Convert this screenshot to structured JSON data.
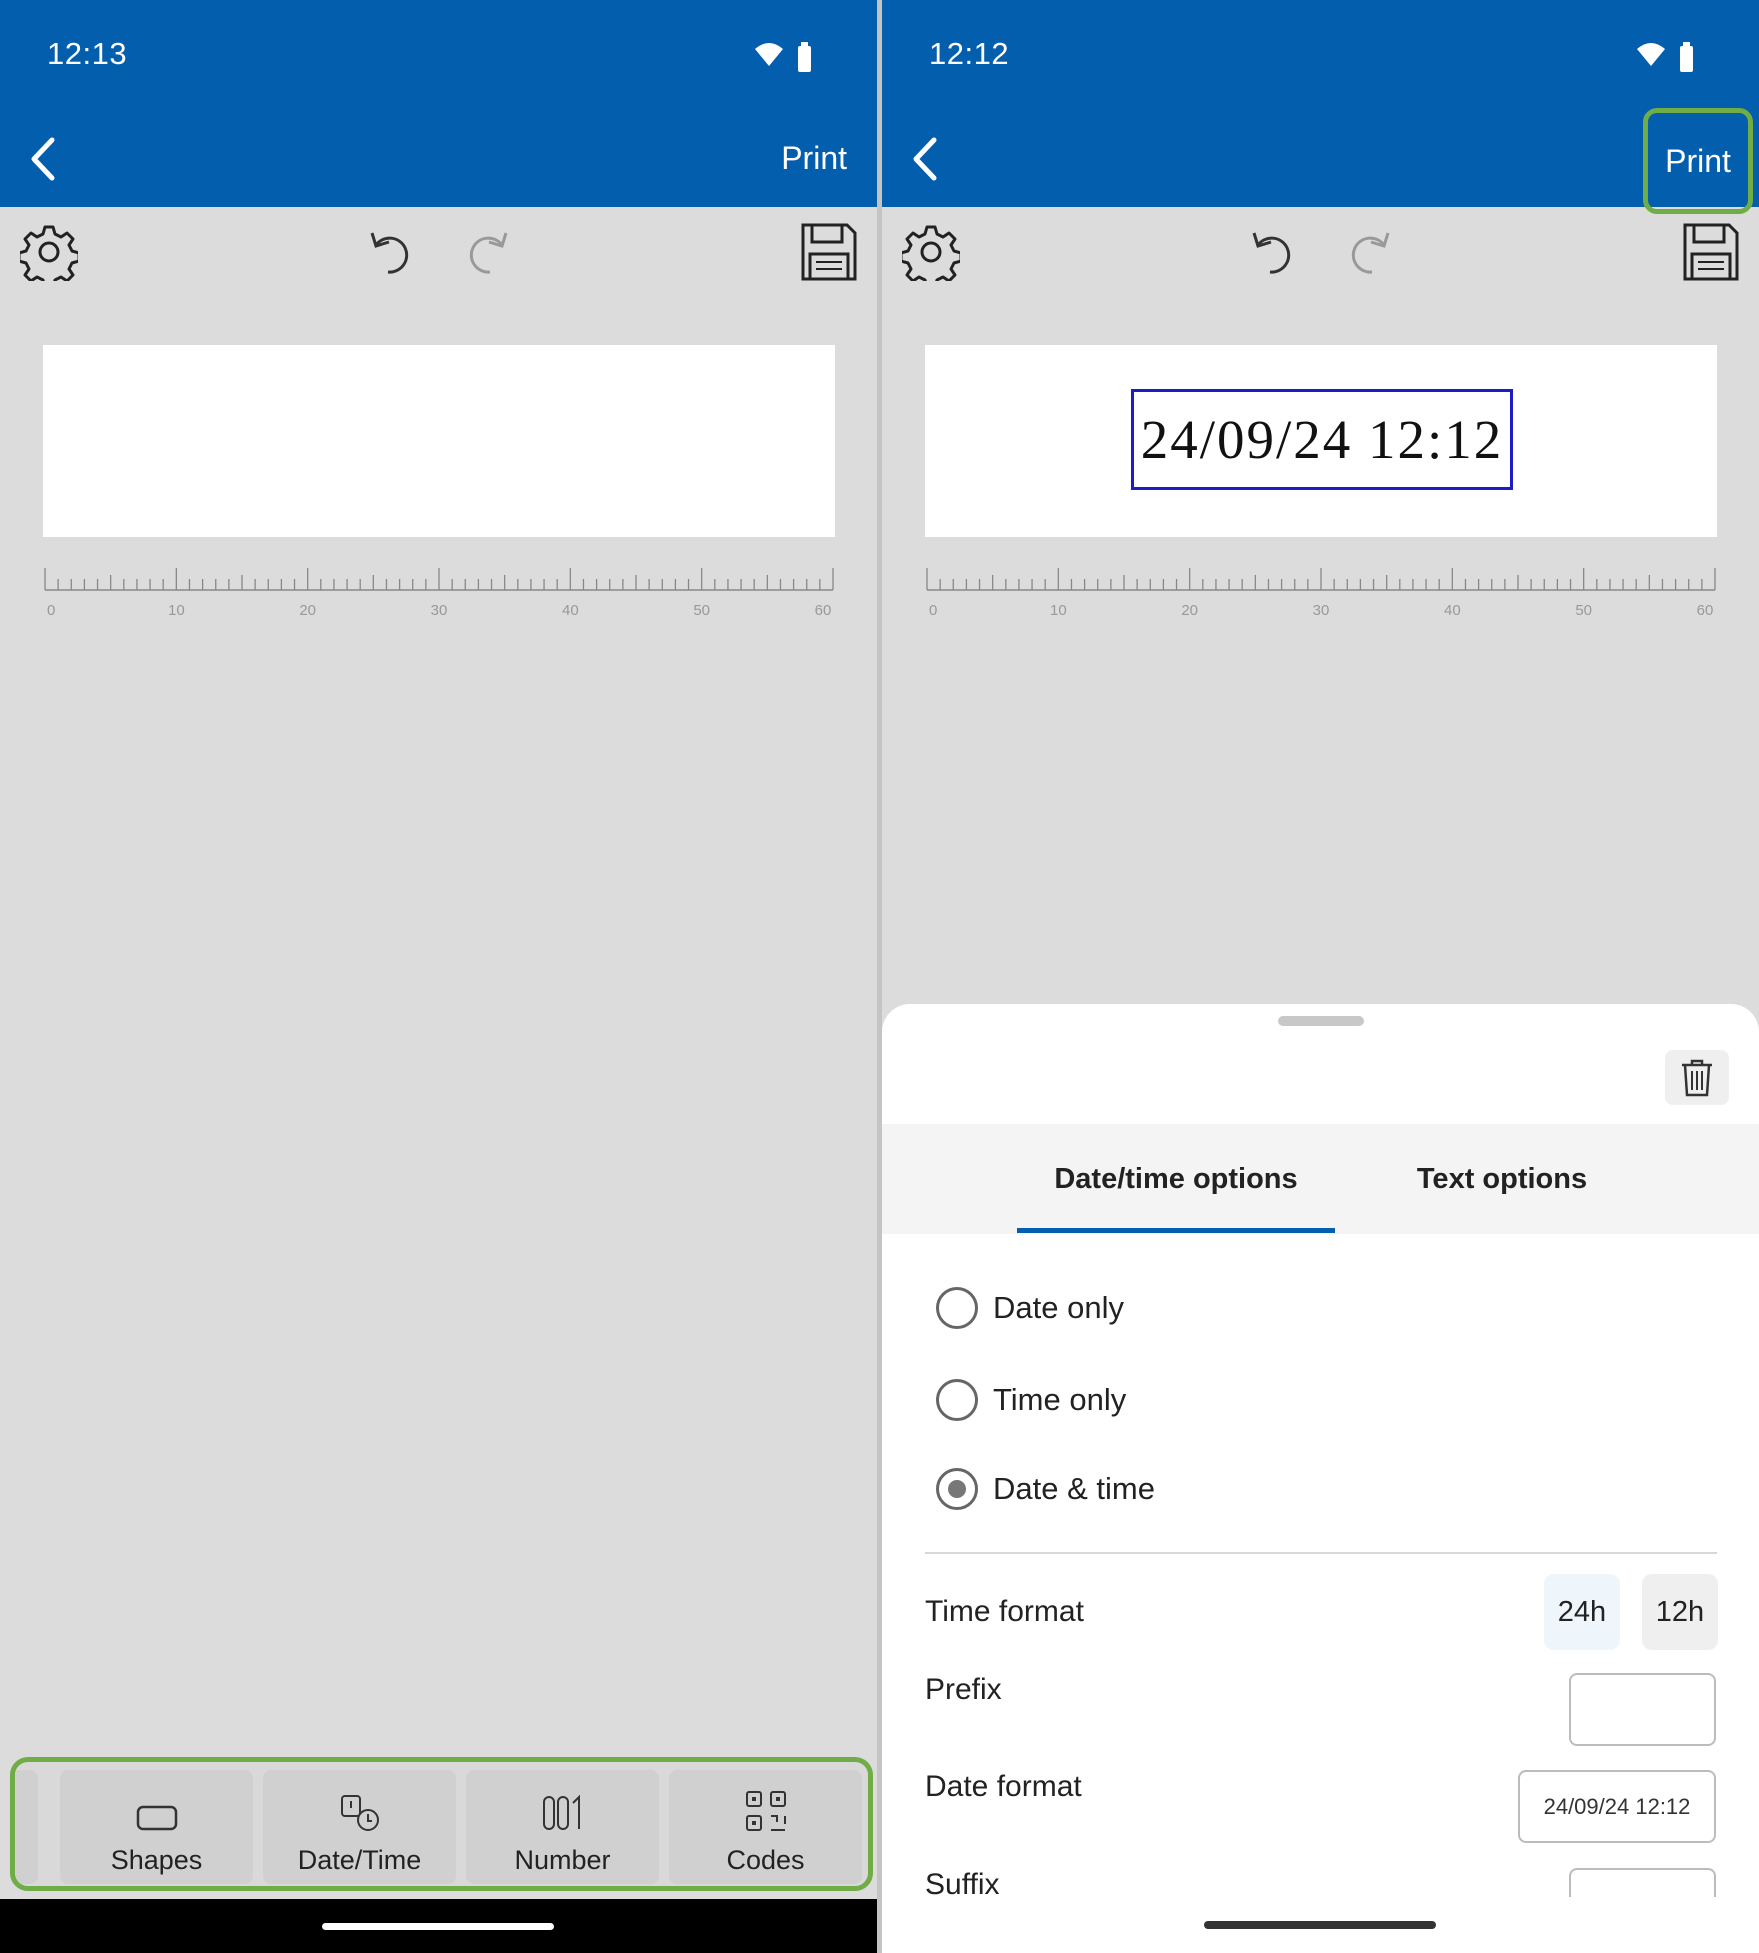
{
  "left": {
    "status": {
      "time": "12:13"
    },
    "appbar": {
      "print_label": "Print"
    },
    "ruler": {
      "ticks": [
        "0",
        "10",
        "20",
        "30",
        "40",
        "50",
        "60"
      ]
    },
    "insert_bar": {
      "items": [
        {
          "label": "Shapes",
          "icon": "shapes-icon"
        },
        {
          "label": "Date/Time",
          "icon": "datetime-icon"
        },
        {
          "label": "Number",
          "icon": "number-icon"
        },
        {
          "label": "Codes",
          "icon": "qr-codes-icon"
        }
      ]
    }
  },
  "right": {
    "status": {
      "time": "12:12"
    },
    "appbar": {
      "print_label": "Print"
    },
    "canvas": {
      "datetime_text": "24/09/24 12:12"
    },
    "ruler": {
      "ticks": [
        "0",
        "10",
        "20",
        "30",
        "40",
        "50",
        "60"
      ]
    },
    "sheet": {
      "tabs": [
        {
          "label": "Date/time options",
          "active": true
        },
        {
          "label": "Text options",
          "active": false
        }
      ],
      "mode_options": [
        {
          "label": "Date only",
          "checked": false
        },
        {
          "label": "Time only",
          "checked": false
        },
        {
          "label": "Date & time",
          "checked": true
        }
      ],
      "time_format": {
        "label": "Time format",
        "options": [
          "24h",
          "12h"
        ],
        "selected": "24h"
      },
      "prefix": {
        "label": "Prefix",
        "value": ""
      },
      "date_format": {
        "label": "Date format",
        "value": "24/09/24 12:12"
      },
      "suffix": {
        "label": "Suffix",
        "value": ""
      }
    }
  },
  "colors": {
    "appbar": "#045eae",
    "highlight": "#70ad47",
    "selection": "#1c1cc8"
  }
}
